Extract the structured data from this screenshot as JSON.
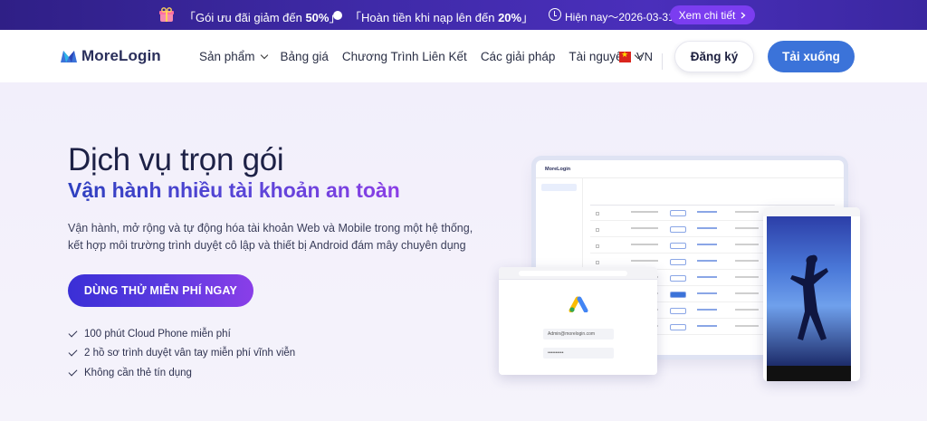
{
  "promo": {
    "text1_prefix": "「Gói ưu đãi giảm đến ",
    "text1_bold": "50%",
    "text1_suffix": "」",
    "text2_prefix": "「Hoàn tiền khi nạp lên đến ",
    "text2_bold": "20%",
    "text2_suffix": "」",
    "date_text": "Hiện nay～2026-03-31",
    "detail_label": "Xem chi tiết",
    "detail_icon": "chevron-right-icon"
  },
  "header": {
    "logo_text": "MoreLogin",
    "nav": [
      {
        "label": "Sản phẩm",
        "has_dropdown": true
      },
      {
        "label": "Bảng giá",
        "has_dropdown": false
      },
      {
        "label": "Chương Trình Liên Kết",
        "has_dropdown": false
      },
      {
        "label": "Các giải pháp",
        "has_dropdown": false
      },
      {
        "label": "Tài nguyên",
        "has_dropdown": true
      }
    ],
    "language": "VN",
    "register_label": "Đăng ký",
    "download_label": "Tải xuống"
  },
  "hero": {
    "title": "Dịch vụ trọn gói",
    "subtitle": "Vận hành nhiều tài khoản an toàn",
    "description_line1": "Vận hành, mở rộng và tự động hóa tài khoản Web và Mobile trong một hệ thống,",
    "description_line2": "kết hợp môi trường trình duyệt cô lập và thiết bị Android đám mây chuyên dụng",
    "cta_label": "DÙNG THỬ MIỄN PHÍ NGAY",
    "features": [
      "100 phút Cloud Phone miễn phí",
      "2 hồ sơ trình duyệt vân tay miễn phí vĩnh viễn",
      "Không cần thẻ tín dụng"
    ]
  },
  "mockup": {
    "app_name": "MoreLogin",
    "login_email": "Admin@morelogin.com",
    "login_password": "••••••••••"
  },
  "colors": {
    "promo_bg": "#3f2aa8",
    "accent_purple": "#7b3df0",
    "download_blue": "#3b73d9",
    "title_dark": "#1d2146"
  }
}
